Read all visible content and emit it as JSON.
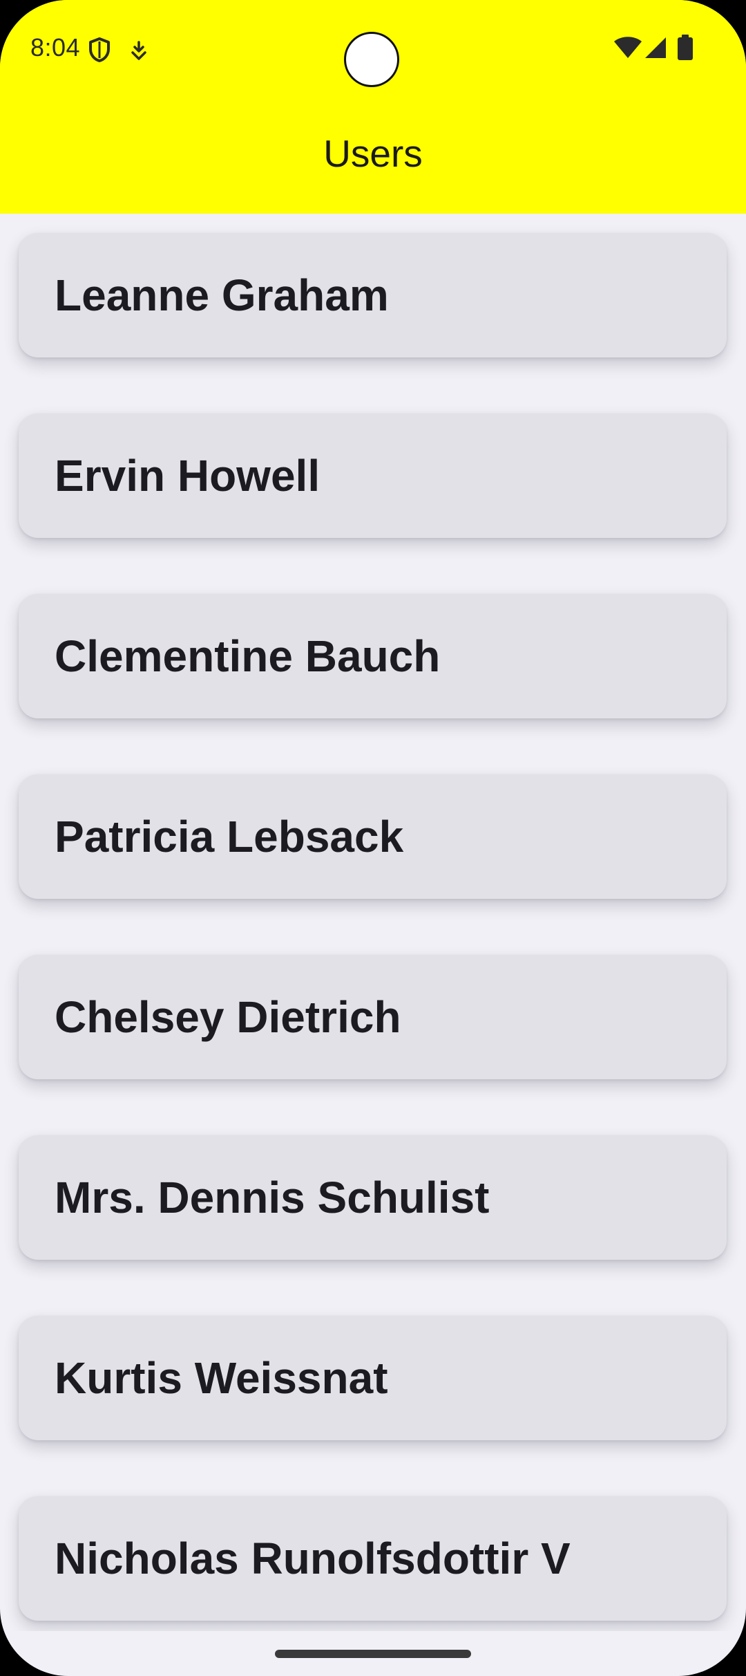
{
  "status_bar": {
    "time": "8:04"
  },
  "app_bar": {
    "title": "Users",
    "background_color": "#ffff00"
  },
  "users": [
    {
      "name": "Leanne Graham"
    },
    {
      "name": "Ervin Howell"
    },
    {
      "name": "Clementine Bauch"
    },
    {
      "name": "Patricia Lebsack"
    },
    {
      "name": "Chelsey Dietrich"
    },
    {
      "name": "Mrs. Dennis Schulist"
    },
    {
      "name": "Kurtis Weissnat"
    },
    {
      "name": "Nicholas Runolfsdottir V"
    }
  ],
  "colors": {
    "card_background": "#e2e1e7",
    "page_background": "#f1f0f6",
    "text": "#1c1b22"
  }
}
